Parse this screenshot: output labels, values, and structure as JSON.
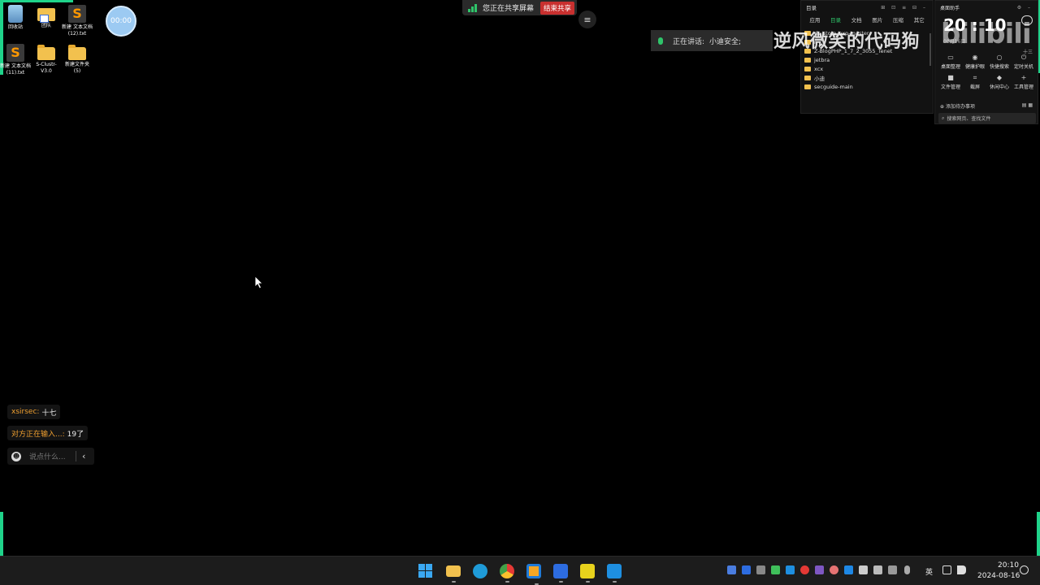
{
  "desktop": {
    "icons": [
      {
        "label": "回收站"
      },
      {
        "label": "团队"
      },
      {
        "label": "新建 文本文档 (12).txt"
      },
      {
        "label": "新建 文本文档 (11).txt"
      },
      {
        "label": "S-Clustr-V3.0"
      },
      {
        "label": "新建文件夹 (5)"
      }
    ],
    "timer": "00:00"
  },
  "share_bar": {
    "status": "您正在共享屏幕",
    "end_button": "结束共享"
  },
  "speaking": {
    "label": "正在讲话:",
    "name": "小迪安全;"
  },
  "watermark": {
    "text": "逆风微笑的代码狗",
    "logo": "bilibili"
  },
  "directory_panel": {
    "title": "目录",
    "tabs": [
      "应用",
      "目录",
      "文档",
      "图片",
      "压缩",
      "其它"
    ],
    "active_tab": "目录",
    "items": [
      "ds_store_exp-master",
      "r",
      "Z-BlogPHP_1_7_2_3055_Tenet",
      "jetbra",
      "xcx",
      "小迪",
      "secguide-main"
    ]
  },
  "assistant": {
    "title": "桌面助手",
    "time": "20 : 10",
    "date": "08月16日",
    "lunar": "十三",
    "tools": [
      {
        "icon": "desktop-organize-icon",
        "label": "桌面整理"
      },
      {
        "icon": "eye-care-icon",
        "label": "健康护眼"
      },
      {
        "icon": "quick-search-icon",
        "label": "快捷搜索"
      },
      {
        "icon": "power-icon",
        "label": "定时关机"
      },
      {
        "icon": "folder-icon",
        "label": "文件管理"
      },
      {
        "icon": "crop-icon",
        "label": "截屏"
      },
      {
        "icon": "game-icon",
        "label": "休闲中心"
      },
      {
        "icon": "plus-icon",
        "label": "工具管理"
      }
    ],
    "todo": "添加待办事项",
    "search_placeholder": "搜索网页、查找文件"
  },
  "chat": {
    "messages": [
      {
        "user": "xsirsec:",
        "text": "十七"
      },
      {
        "user": "对方正在输入...:",
        "text": "19了"
      }
    ],
    "input_placeholder": "说点什么...",
    "collapse": "‹"
  },
  "taskbar": {
    "language": "英",
    "time": "20:10",
    "date": "2024-08-16"
  },
  "colors": {
    "accent_green": "#1fd38a",
    "end_share_red": "#c8302f",
    "chat_user": "#f0a030"
  }
}
